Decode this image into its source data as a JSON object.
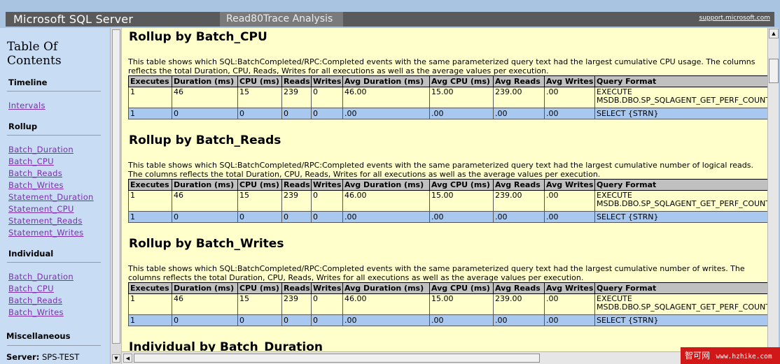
{
  "header": {
    "app_title": "Microsoft SQL Server",
    "app_subtitle": "Read80Trace Analysis",
    "support_link": "support.microsoft.com"
  },
  "nav": {
    "toc_title": "Table Of Contents",
    "sections": [
      {
        "label": "Timeline",
        "links": [
          "Intervals"
        ]
      },
      {
        "label": "Rollup",
        "links": [
          "Batch_Duration",
          "Batch_CPU",
          "Batch_Reads",
          "Batch_Writes",
          "Statement_Duration",
          "Statement_CPU",
          "Statement_Reads",
          "Statement_Writes"
        ]
      },
      {
        "label": "Individual",
        "links": [
          "Batch_Duration",
          "Batch_CPU",
          "Batch_Reads",
          "Batch_Writes"
        ]
      },
      {
        "label": "Miscellaneous",
        "links": []
      }
    ],
    "server_label": "Server:",
    "server_value": "SPS-TEST"
  },
  "columns": [
    "Executes",
    "Duration (ms)",
    "CPU (ms)",
    "Reads",
    "Writes",
    "Avg Duration (ms)",
    "Avg CPU (ms)",
    "Avg Reads",
    "Avg Writes",
    "Query Format"
  ],
  "sections": [
    {
      "title": "Rollup by Batch_CPU",
      "desc": "This table shows which SQL:BatchCompleted/RPC:Completed events with the same parameterized query text had the largest cumulative CPU usage. The columns reflects the total Duration, CPU, Reads, Writes for all executions as well as the average values per execution.",
      "rows": [
        [
          "1",
          "46",
          "15",
          "239",
          "0",
          "46.00",
          "15.00",
          "239.00",
          ".00",
          "EXECUTE MSDB.DBO.SP_SQLAGENT_GET_PERF_COUNTERS"
        ],
        [
          "1",
          "0",
          "0",
          "0",
          "0",
          ".00",
          ".00",
          ".00",
          ".00",
          "SELECT {STRN}"
        ]
      ]
    },
    {
      "title": "Rollup by Batch_Reads",
      "desc": "This table shows which SQL:BatchCompleted/RPC:Completed events with the same parameterized query text had the largest cumulative number of logical reads. The columns reflects the total Duration, CPU, Reads, Writes for all executions as well as the average values per execution.",
      "rows": [
        [
          "1",
          "46",
          "15",
          "239",
          "0",
          "46.00",
          "15.00",
          "239.00",
          ".00",
          "EXECUTE MSDB.DBO.SP_SQLAGENT_GET_PERF_COUNTERS"
        ],
        [
          "1",
          "0",
          "0",
          "0",
          "0",
          ".00",
          ".00",
          ".00",
          ".00",
          "SELECT {STRN}"
        ]
      ]
    },
    {
      "title": "Rollup by Batch_Writes",
      "desc": "This table shows which SQL:BatchCompleted/RPC:Completed events with the same parameterized query text had the largest cumulative number of writes. The columns reflects the total Duration, CPU, Reads, Writes for all executions as well as the average values per execution.",
      "rows": [
        [
          "1",
          "46",
          "15",
          "239",
          "0",
          "46.00",
          "15.00",
          "239.00",
          ".00",
          "EXECUTE MSDB.DBO.SP_SQLAGENT_GET_PERF_COUNTERS"
        ],
        [
          "1",
          "0",
          "0",
          "0",
          "0",
          ".00",
          ".00",
          ".00",
          ".00",
          "SELECT {STRN}"
        ]
      ]
    },
    {
      "title": "Individual by Batch_Duration"
    }
  ],
  "watermark": {
    "cn": "智可网",
    "url": "www.hzhike.com"
  }
}
